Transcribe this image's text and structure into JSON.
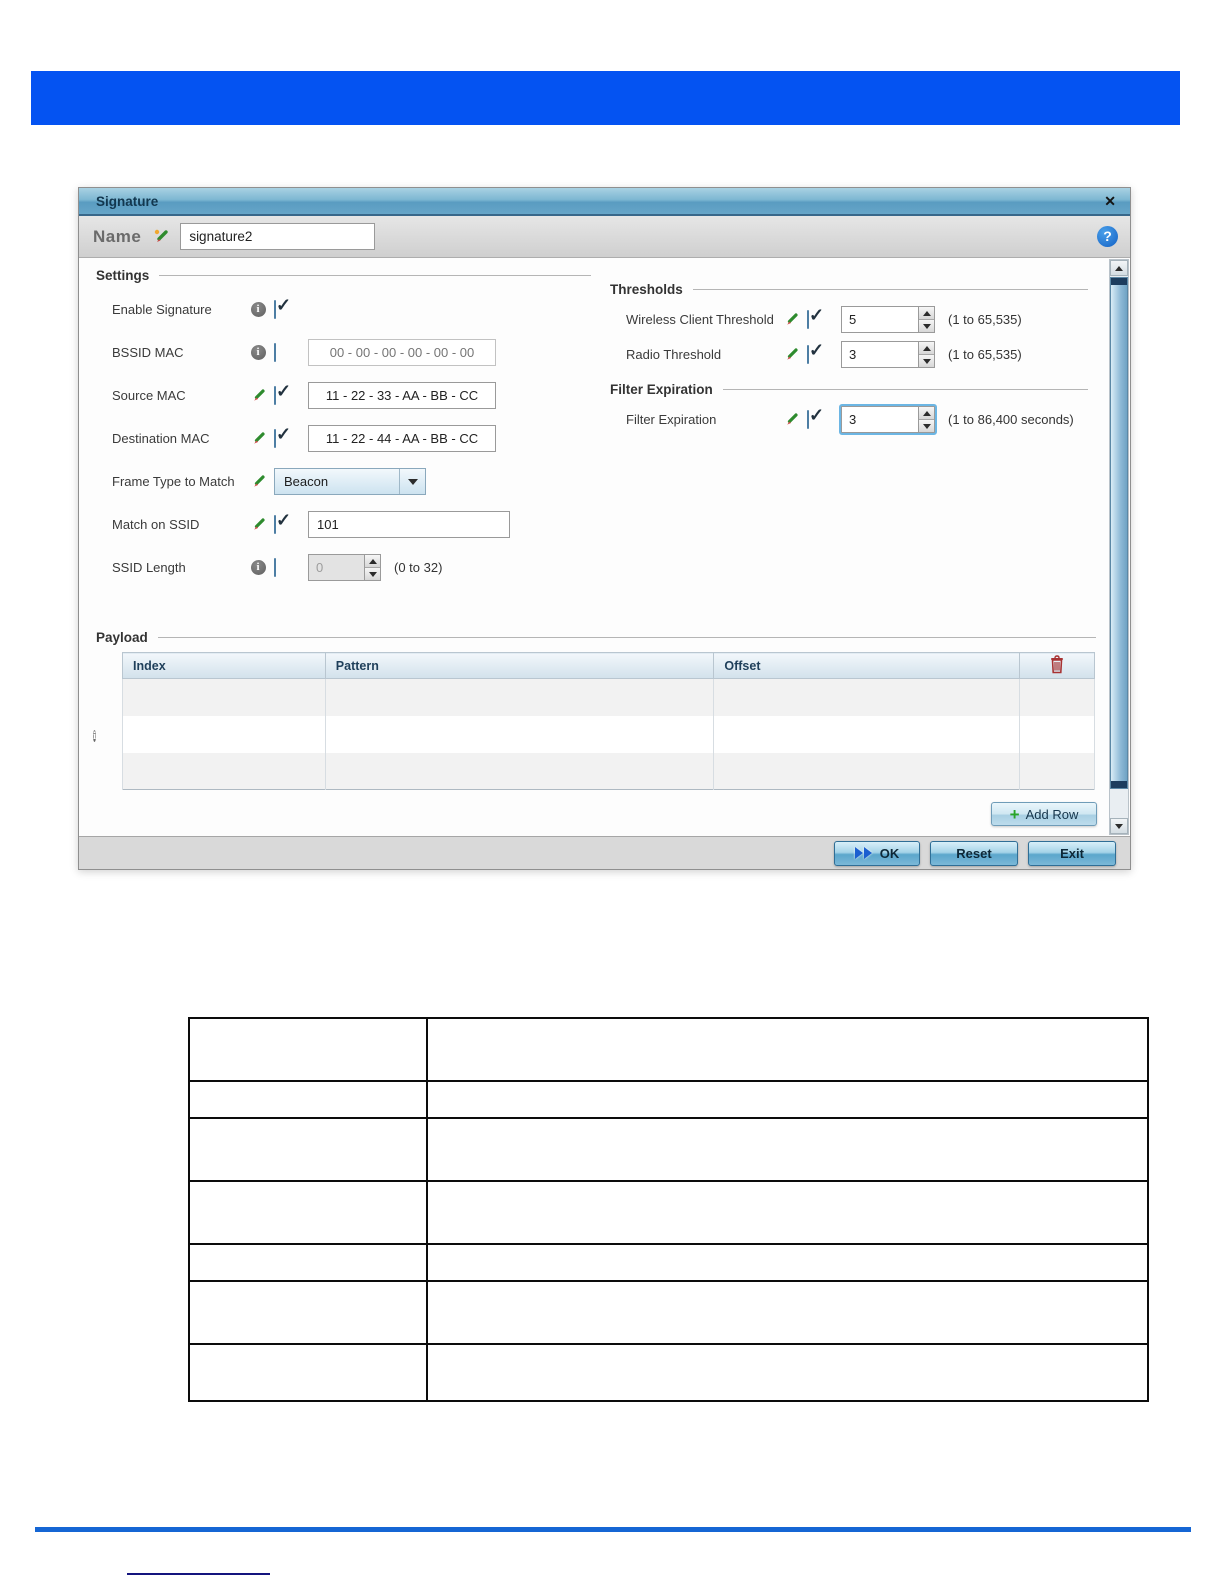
{
  "icons": {
    "close": "✕",
    "help": "?",
    "info": "i",
    "check": "✓",
    "plus": "+"
  },
  "dialog": {
    "title": "Signature",
    "name_label": "Name",
    "name_value": "signature2",
    "settings": {
      "heading": "Settings",
      "enable_signature_label": "Enable Signature",
      "bssid_mac_label": "BSSID MAC",
      "bssid_mac_placeholder": "00 - 00 - 00 - 00 - 00 - 00",
      "source_mac_label": "Source MAC",
      "source_mac_value": "11 - 22 - 33 - AA - BB - CC",
      "destination_mac_label": "Destination MAC",
      "destination_mac_value": "11 - 22 - 44 - AA - BB - CC",
      "frame_type_label": "Frame Type to Match",
      "frame_type_value": "Beacon",
      "match_ssid_label": "Match on SSID",
      "match_ssid_value": "101",
      "ssid_length_label": "SSID Length",
      "ssid_length_value": "0",
      "ssid_length_range": "(0 to 32)"
    },
    "thresholds": {
      "heading": "Thresholds",
      "wireless_label": "Wireless Client Threshold",
      "wireless_value": "5",
      "wireless_range": "(1 to 65,535)",
      "radio_label": "Radio Threshold",
      "radio_value": "3",
      "radio_range": "(1 to 65,535)"
    },
    "filter_expiration": {
      "heading": "Filter Expiration",
      "label": "Filter Expiration",
      "value": "3",
      "range": "(1 to 86,400 seconds)"
    },
    "payload": {
      "heading": "Payload",
      "columns": [
        "Index",
        "Pattern",
        "Offset"
      ],
      "add_row_label": "Add Row"
    },
    "footer": {
      "ok_label": "OK",
      "reset_label": "Reset",
      "exit_label": "Exit"
    }
  },
  "colors": {
    "banner_blue": "#0453f2",
    "rule_blue": "#1566d4",
    "titlebar_blue": "#5a9cc1",
    "accent_button_blue": "#5ba6cc",
    "trash_red": "#a83232",
    "pencil_green": "#2e8b2e"
  }
}
